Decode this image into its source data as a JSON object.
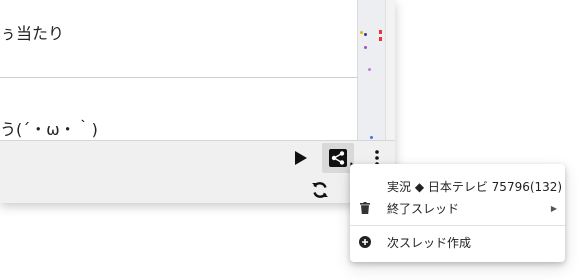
{
  "messages": [
    {
      "text": "ぅ当たり"
    },
    {
      "text": "う(´・ω・｀)"
    }
  ],
  "toolbar": {
    "play_icon": "play-icon",
    "share_icon": "share-icon",
    "more_icon": "more-vert-icon",
    "refresh_icon": "refresh-icon",
    "share_active_bg": "#d9d9d9"
  },
  "context_menu": {
    "items": [
      {
        "label": "実況 ◆ 日本テレビ 75796(132)",
        "icon": ""
      },
      {
        "label": "終了スレッド",
        "icon": "trash-icon",
        "has_submenu": true,
        "submenu_arrow": "▶"
      },
      {
        "label": "次スレッド作成",
        "icon": "add-circle-icon"
      }
    ]
  }
}
